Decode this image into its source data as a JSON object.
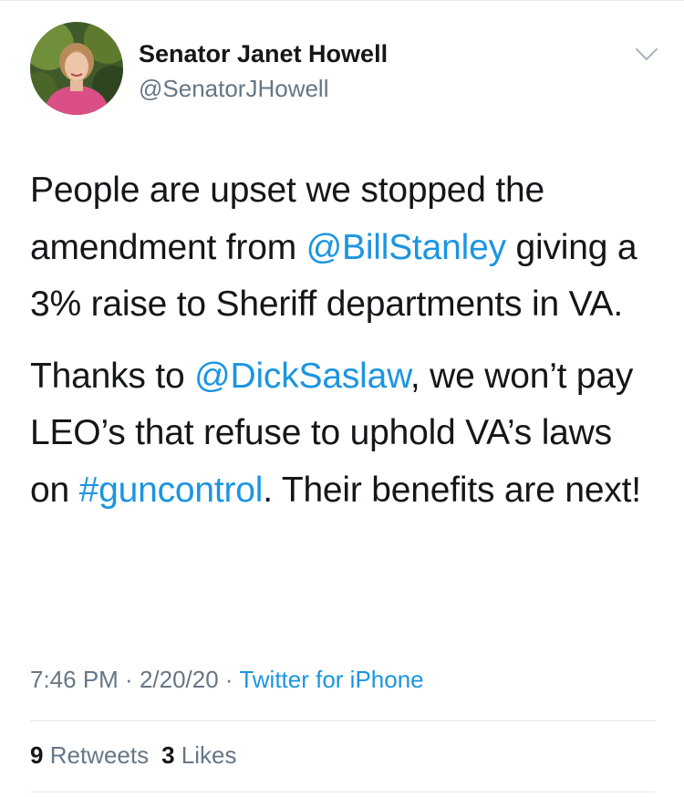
{
  "user": {
    "display_name": "Senator Janet Howell",
    "handle": "@SenatorJHowell"
  },
  "tweet": {
    "p1_text_a": "People are upset we stopped the amendment from ",
    "p1_mention": "@BillStanley",
    "p1_text_b": " giving a 3% raise to Sheriff departments in VA.",
    "p2_text_a": "Thanks to ",
    "p2_mention": "@DickSaslaw",
    "p2_text_b": ", we won’t pay LEO’s that refuse to uphold VA’s laws on ",
    "p2_hashtag": "#guncontrol",
    "p2_text_c": ". Their benefits are next!"
  },
  "meta": {
    "time": "7:46 PM",
    "separator": " · ",
    "date": "2/20/20",
    "source": "Twitter for iPhone"
  },
  "stats": {
    "retweets_count": "9",
    "retweets_label": "Retweets",
    "likes_count": "3",
    "likes_label": "Likes"
  },
  "colors": {
    "link": "#1b95e0",
    "secondary_text": "#657786",
    "primary_text": "#14171a"
  },
  "icons": {
    "menu": "chevron-down-icon"
  }
}
